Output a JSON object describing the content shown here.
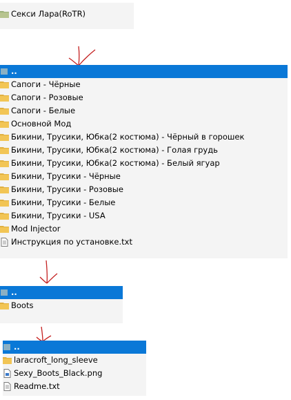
{
  "theme": {
    "selection_color": "#0a78d7",
    "folder_color": "#f2c555",
    "panel_bg": "#f4f4f4"
  },
  "panel_top": {
    "items": [
      {
        "label": "Секси Лара(RoTR)",
        "icon": "folder-green-icon"
      }
    ]
  },
  "panel_main": {
    "items": [
      {
        "label": "..",
        "icon": "up-folder-icon"
      },
      {
        "label": "Сапоги - Чёрные",
        "icon": "folder-icon"
      },
      {
        "label": "Сапоги - Розовые",
        "icon": "folder-icon"
      },
      {
        "label": "Сапоги - Белые",
        "icon": "folder-icon"
      },
      {
        "label": "Основной Мод",
        "icon": "folder-icon"
      },
      {
        "label": "Бикини, Трусики, Юбка(2 костюма) - Чёрный в горошек",
        "icon": "folder-icon"
      },
      {
        "label": "Бикини, Трусики, Юбка(2 костюма) - Голая грудь",
        "icon": "folder-icon"
      },
      {
        "label": "Бикини, Трусики, Юбка(2 костюма) - Белый ягуар",
        "icon": "folder-icon"
      },
      {
        "label": "Бикини, Трусики - Чёрные",
        "icon": "folder-icon"
      },
      {
        "label": "Бикини, Трусики - Розовые",
        "icon": "folder-icon"
      },
      {
        "label": "Бикини, Трусики - Белые",
        "icon": "folder-icon"
      },
      {
        "label": "Бикини, Трусики - USA",
        "icon": "folder-icon"
      },
      {
        "label": "Mod Injector",
        "icon": "folder-icon"
      },
      {
        "label": "Инструкция по установке.txt",
        "icon": "text-file-icon"
      }
    ]
  },
  "panel_boots": {
    "items": [
      {
        "label": "..",
        "icon": "up-folder-icon"
      },
      {
        "label": "Boots",
        "icon": "folder-icon"
      }
    ]
  },
  "panel_files": {
    "items": [
      {
        "label": "..",
        "icon": "up-folder-icon"
      },
      {
        "label": "laracroft_long_sleeve",
        "icon": "folder-icon"
      },
      {
        "label": "Sexy_Boots_Black.png",
        "icon": "image-file-icon"
      },
      {
        "label": "Readme.txt",
        "icon": "text-file-icon"
      }
    ]
  }
}
